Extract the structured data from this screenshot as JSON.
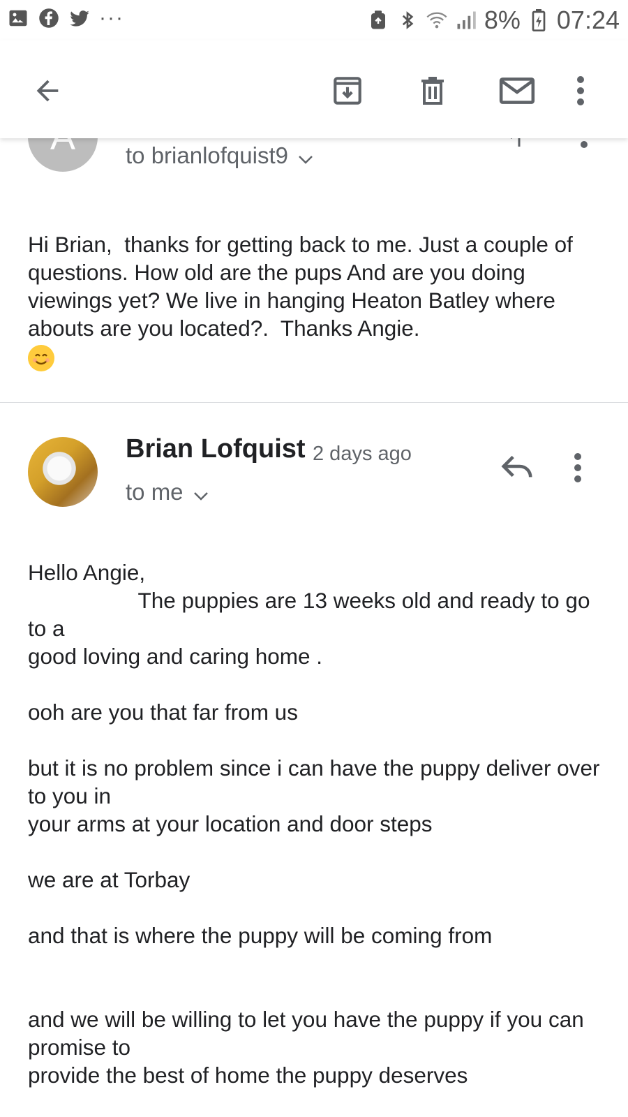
{
  "status_bar": {
    "battery": "8%",
    "time": "07:24",
    "overflow": "···"
  },
  "toolbar": {
    "icons": [
      "back-arrow-icon",
      "archive-icon",
      "delete-icon",
      "mark-unread-icon",
      "more-vert-icon"
    ]
  },
  "previous_message": {
    "avatar_letter": "A",
    "recipient": "to brianlofquist9",
    "body": "Hi Brian,  thanks for getting back to me. Just a couple of questions. How old are the pups And are you doing viewings yet? We live in hanging Heaton Batley where abouts are you located?.  Thanks Angie. "
  },
  "message": {
    "sender": "Brian Lofquist",
    "time": "2 days ago",
    "recipient": "to me",
    "body": "Hello Angie,\n                  The puppies are 13 weeks old and ready to go to a\ngood loving and caring home .\n\nooh are you that far from us\n\nbut it is no problem since i can have the puppy deliver over to you in\nyour arms at your location and door steps\n\nwe are at Torbay\n\nand that is where the puppy will be coming from\n\n\nand we will be willing to let you have the puppy if you can promise to\nprovide the best of home the puppy deserves"
  },
  "colors": {
    "text": "#202124",
    "secondary_text": "#5f6368",
    "divider": "#dadce0",
    "placeholder_avatar": "#bdbdbd"
  }
}
